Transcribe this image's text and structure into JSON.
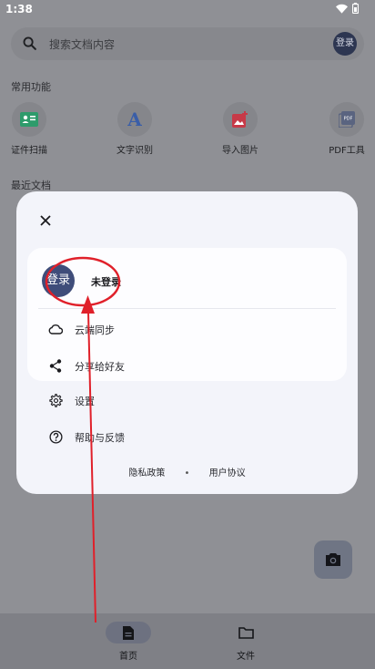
{
  "status_bar": {
    "time": "1:38"
  },
  "search": {
    "placeholder": "搜索文档内容",
    "login_label": "登录"
  },
  "sections": {
    "common_tools": "常用功能",
    "recent_docs": "最近文档"
  },
  "features": [
    {
      "label": "证件扫描",
      "icon": "id-card-icon",
      "color": "#2e9b6b"
    },
    {
      "label": "文字识别",
      "icon": "text-a-icon",
      "color": "#3a5ea8"
    },
    {
      "label": "导入图片",
      "icon": "add-image-icon",
      "color": "#c73a48"
    },
    {
      "label": "PDF工具",
      "icon": "pdf-icon",
      "color": "#5a6480"
    }
  ],
  "dialog": {
    "avatar_label": "登录",
    "user_name": "未登录",
    "menu": [
      {
        "label": "云端同步",
        "icon": "cloud-icon"
      },
      {
        "label": "分享给好友",
        "icon": "share-icon"
      },
      {
        "label": "设置",
        "icon": "gear-icon"
      },
      {
        "label": "帮助与反馈",
        "icon": "help-icon"
      }
    ],
    "privacy_policy": "隐私政策",
    "separator": "•",
    "user_agreement": "用户协议"
  },
  "bottom_nav": {
    "items": [
      {
        "label": "首页",
        "icon": "document-icon",
        "active": true
      },
      {
        "label": "文件",
        "icon": "folder-icon",
        "active": false
      }
    ]
  },
  "colors": {
    "annotation_red": "#e0202a",
    "accent": "#3f4d7a"
  }
}
